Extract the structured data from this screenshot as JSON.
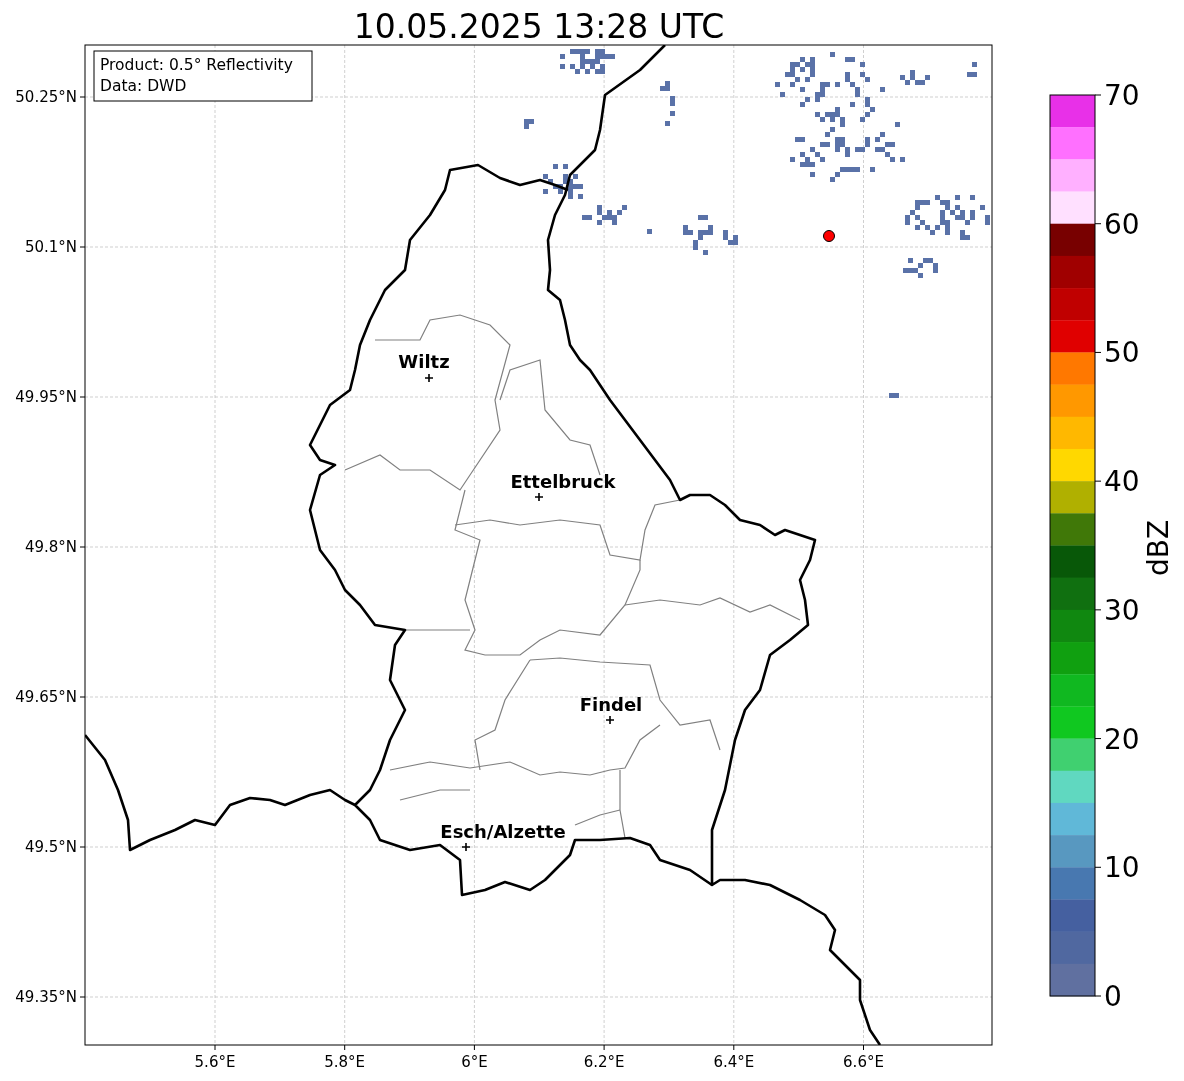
{
  "title": "10.05.2025 13:28 UTC",
  "info_box": {
    "lines": [
      "Product: 0.5° Reflectivity",
      "Data: DWD"
    ]
  },
  "map": {
    "lat_ticks": [
      "50.25°N",
      "50.1°N",
      "49.95°N",
      "49.8°N",
      "49.65°N",
      "49.5°N",
      "49.35°N"
    ],
    "lon_ticks": [
      "5.6°E",
      "5.8°E",
      "6°E",
      "6.2°E",
      "6.4°E",
      "6.6°E"
    ],
    "cities": [
      {
        "name": "Wiltz"
      },
      {
        "name": "Ettelbruck"
      },
      {
        "name": "Findel"
      },
      {
        "name": "Esch/Alzette"
      }
    ]
  },
  "colorbar": {
    "label": "dBZ",
    "ticks": [
      "70",
      "60",
      "50",
      "40",
      "30",
      "20",
      "10",
      "0"
    ],
    "bands": [
      {
        "color": "#e830e8"
      },
      {
        "color": "#ff70ff"
      },
      {
        "color": "#ffb0ff"
      },
      {
        "color": "#ffe0ff"
      },
      {
        "color": "#780000"
      },
      {
        "color": "#a00000"
      },
      {
        "color": "#c00000"
      },
      {
        "color": "#e00000"
      },
      {
        "color": "#ff7800"
      },
      {
        "color": "#ff9800"
      },
      {
        "color": "#ffb800"
      },
      {
        "color": "#ffd800"
      },
      {
        "color": "#b0b000"
      },
      {
        "color": "#407808"
      },
      {
        "color": "#085808"
      },
      {
        "color": "#107010"
      },
      {
        "color": "#108810"
      },
      {
        "color": "#10a010"
      },
      {
        "color": "#10b820"
      },
      {
        "color": "#10c820"
      },
      {
        "color": "#40d070"
      },
      {
        "color": "#60d8c0"
      },
      {
        "color": "#60b8d8"
      },
      {
        "color": "#5898c0"
      },
      {
        "color": "#4878b0"
      },
      {
        "color": "#4560a0"
      },
      {
        "color": "#5068a0"
      },
      {
        "color": "#6070a0"
      }
    ]
  }
}
